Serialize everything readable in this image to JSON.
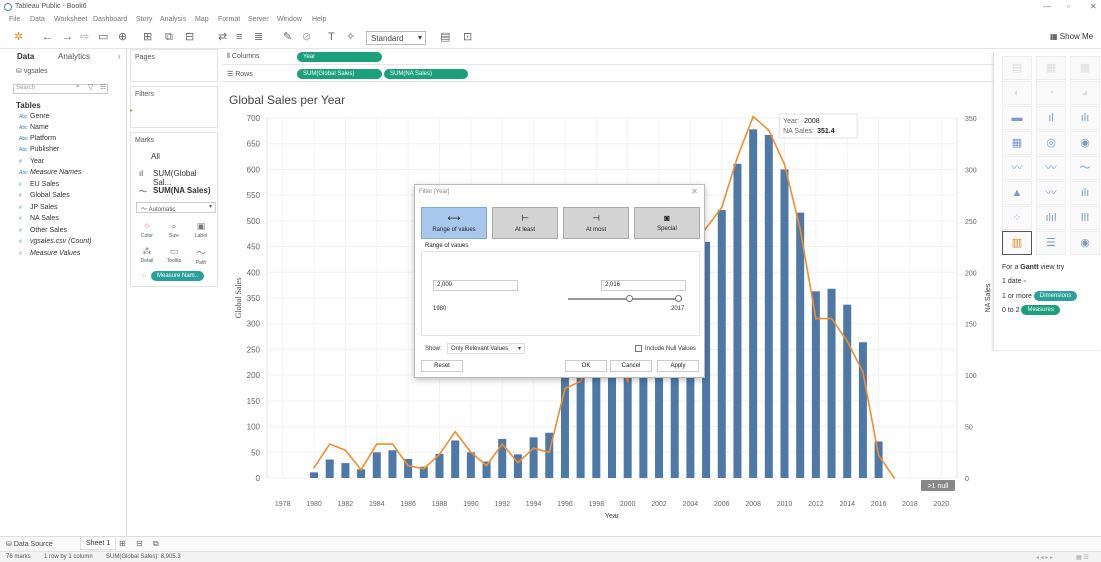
{
  "app": {
    "title": "Tableau Public - Book6"
  },
  "menu": [
    "File",
    "Data",
    "Worksheet",
    "Dashboard",
    "Story",
    "Analysis",
    "Map",
    "Format",
    "Server",
    "Window",
    "Help"
  ],
  "toolbar": {
    "fit_mode": "Standard",
    "show_me": "Show Me"
  },
  "left_pane": {
    "tab_data": "Data",
    "tab_analytics": "Analytics",
    "data_source": "vgsales",
    "search_placeholder": "Search",
    "tables_heading": "Tables",
    "fields": [
      {
        "icon": "Abc",
        "name": "Genre",
        "kind": "dim"
      },
      {
        "icon": "Abc",
        "name": "Name",
        "kind": "dim"
      },
      {
        "icon": "Abc",
        "name": "Platform",
        "kind": "dim"
      },
      {
        "icon": "Abc",
        "name": "Publisher",
        "kind": "dim"
      },
      {
        "icon": "#",
        "name": "Year",
        "kind": "dim"
      },
      {
        "icon": "Abc",
        "name": "Measure Names",
        "kind": "dim",
        "italic": true
      },
      {
        "icon": "#",
        "name": "EU Sales",
        "kind": "mea"
      },
      {
        "icon": "#",
        "name": "Global Sales",
        "kind": "mea"
      },
      {
        "icon": "#",
        "name": "JP Sales",
        "kind": "mea"
      },
      {
        "icon": "#",
        "name": "NA Sales",
        "kind": "mea"
      },
      {
        "icon": "#",
        "name": "Other Sales",
        "kind": "mea"
      },
      {
        "icon": "#",
        "name": "vgsales.csv (Count)",
        "kind": "mea",
        "italic": true
      },
      {
        "icon": "#",
        "name": "Measure Values",
        "kind": "mea",
        "italic": true
      }
    ]
  },
  "cards": {
    "pages": "Pages",
    "filters": "Filters",
    "marks": "Marks",
    "marks_all": "All",
    "marks_sum_global": "SUM(Global Sal...",
    "marks_sum_na": "SUM(NA Sales)",
    "mark_type": "Automatic",
    "color": "Color",
    "size": "Size",
    "label": "Label",
    "detail": "Detail",
    "tooltip": "Tooltip",
    "path": "Path",
    "measure_names_pill": "Measure Nam.."
  },
  "shelves": {
    "columns_label": "Columns",
    "rows_label": "Rows",
    "columns_pill": "Year",
    "rows_pill_1": "SUM(Global Sales)",
    "rows_pill_2": "SUM(NA Sales)"
  },
  "chart_data": {
    "type": "bar",
    "title": "Global Sales per Year",
    "xlabel": "Year",
    "ylabel": "Global Sales",
    "y2label": "NA Sales",
    "ylim": [
      0,
      700
    ],
    "y2lim": [
      0,
      350
    ],
    "yticks": [
      0,
      50,
      100,
      150,
      200,
      250,
      300,
      350,
      400,
      450,
      500,
      550,
      600,
      650,
      700
    ],
    "y2ticks": [
      0,
      50,
      100,
      150,
      200,
      250,
      300,
      350
    ],
    "xticks": [
      1978,
      1980,
      1982,
      1984,
      1986,
      1988,
      1990,
      1992,
      1994,
      1996,
      1998,
      2000,
      2002,
      2004,
      2006,
      2008,
      2010,
      2012,
      2014,
      2016,
      2018,
      2020
    ],
    "xlim": [
      1977,
      2021
    ],
    "series": [
      {
        "name": "Global Sales",
        "type": "bar",
        "color": "#4e79a7",
        "x": [
          1980,
          1981,
          1982,
          1983,
          1984,
          1985,
          1986,
          1987,
          1988,
          1989,
          1990,
          1991,
          1992,
          1993,
          1994,
          1995,
          1996,
          1997,
          1998,
          1999,
          2000,
          2001,
          2002,
          2003,
          2004,
          2005,
          2006,
          2007,
          2008,
          2009,
          2010,
          2011,
          2012,
          2013,
          2014,
          2015,
          2016
        ],
        "values": [
          11,
          36,
          29,
          17,
          50,
          54,
          37,
          22,
          47,
          73,
          50,
          32,
          76,
          46,
          79,
          88,
          199,
          201,
          256,
          251,
          201,
          332,
          395,
          357,
          419,
          459,
          521,
          611,
          678,
          667,
          600,
          516,
          363,
          368,
          337,
          264,
          71
        ]
      },
      {
        "name": "NA Sales",
        "type": "line",
        "color": "#f28e2b",
        "x": [
          1980,
          1981,
          1982,
          1983,
          1984,
          1985,
          1986,
          1987,
          1988,
          1989,
          1990,
          1991,
          1992,
          1993,
          1994,
          1995,
          1996,
          1997,
          1998,
          1999,
          2000,
          2001,
          2002,
          2003,
          2004,
          2005,
          2006,
          2007,
          2008,
          2009,
          2010,
          2011,
          2012,
          2013,
          2014,
          2015,
          2016,
          2017
        ],
        "values": [
          10,
          33,
          27,
          8,
          33,
          33,
          12,
          9,
          23,
          45,
          25,
          12,
          33,
          15,
          29,
          25,
          87,
          94,
          128,
          126,
          94,
          173,
          217,
          194,
          220,
          243,
          263,
          312,
          351.4,
          338,
          305,
          242,
          155,
          155,
          133,
          103,
          22,
          0
        ]
      }
    ],
    "null_indicator": ">1 null",
    "tooltip": {
      "year_label": "Year:",
      "year": "2008",
      "na_label": "NA Sales:",
      "na_value": "351.4"
    }
  },
  "show_me": {
    "gantt_line1_pre": "For a",
    "gantt_bold": "Gantt",
    "gantt_line1_post": "view try",
    "req1": "1 date",
    "req2_pre": "1 or more",
    "req2_pill": "Dimensions",
    "req3_pre": "0 to 2",
    "req3_pill": "Measures"
  },
  "filter_dialog": {
    "title": "Filter [Year]",
    "tabs": [
      "Range of values",
      "At least",
      "At most",
      "Special"
    ],
    "section_label": "Range of values",
    "min_value": "2,000",
    "max_value": "2,016",
    "range_min": "1980",
    "range_max": "2017",
    "slider_from": 2000,
    "slider_to": 2016,
    "show_label": "Show:",
    "show_option": "Only Relevant Values",
    "include_null": "Include Null Values",
    "reset": "Reset",
    "ok": "OK",
    "cancel": "Cancel",
    "apply": "Apply"
  },
  "bottom": {
    "data_source_tab": "Data Source",
    "sheet_tab": "Sheet 1"
  },
  "status": {
    "marks": "76 marks",
    "rows_cols": "1 row by 1 column",
    "sum": "SUM(Global Sales): 8,905.3"
  },
  "colors": {
    "accent_pill": "#1aa07a",
    "bar": "#4e79a7",
    "line": "#f28e2b"
  }
}
